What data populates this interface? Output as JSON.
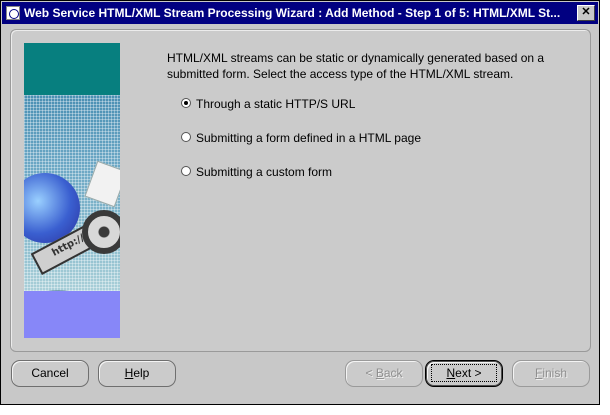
{
  "window": {
    "title": "Web Service HTML/XML Stream Processing Wizard : Add Method - Step 1 of 5: HTML/XML St...",
    "close_glyph": "✕"
  },
  "intro_text": "HTML/XML streams can be static or dynamically generated based on a submitted form. Select the access type of the HTML/XML stream.",
  "image": {
    "film_text": "http://"
  },
  "options": [
    {
      "label": "Through a static HTTP/S URL",
      "selected": true
    },
    {
      "label": "Submitting a form defined in a HTML page",
      "selected": false
    },
    {
      "label": "Submitting a custom form",
      "selected": false
    }
  ],
  "buttons": {
    "cancel": "Cancel",
    "help": {
      "mnemonic": "H",
      "rest": "elp"
    },
    "back": {
      "arrow": "<",
      "mnemonic": "B",
      "rest": "ack"
    },
    "next": {
      "mnemonic": "N",
      "rest": "ext",
      "arrow": ">"
    },
    "finish": {
      "mnemonic": "F",
      "rest": "inish"
    }
  }
}
